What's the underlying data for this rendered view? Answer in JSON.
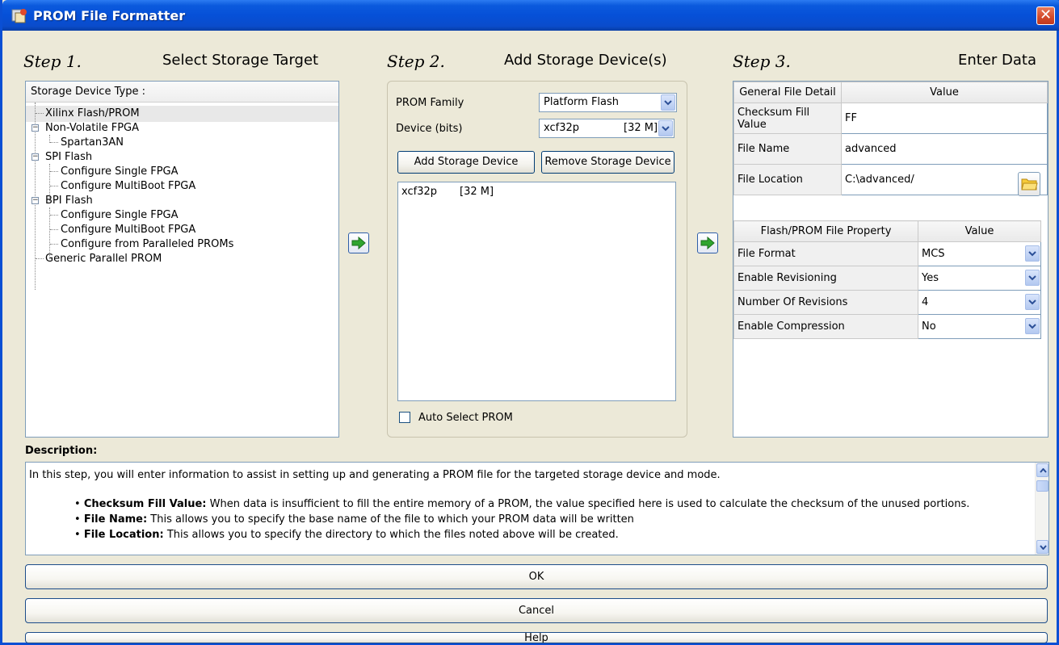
{
  "window": {
    "title": "PROM File Formatter",
    "close_glyph": "✕"
  },
  "steps": [
    {
      "num": "Step 1.",
      "label": "Select Storage Target"
    },
    {
      "num": "Step 2.",
      "label": "Add Storage Device(s)"
    },
    {
      "num": "Step 3.",
      "label": "Enter Data"
    }
  ],
  "storage_tree": {
    "header": "Storage Device Type :",
    "items": [
      "Xilinx Flash/PROM",
      "Non-Volatile FPGA",
      "Spartan3AN",
      "SPI Flash",
      "Configure Single FPGA",
      "Configure MultiBoot FPGA",
      "BPI Flash",
      "Configure Single FPGA",
      "Configure MultiBoot FPGA",
      "Configure from Paralleled PROMs",
      "Generic Parallel PROM"
    ],
    "expander_glyph": "−"
  },
  "step2": {
    "prom_family_label": "PROM Family",
    "prom_family_value": "Platform Flash",
    "device_label": "Device (bits)",
    "device_name": "xcf32p",
    "device_size": "[32 M]",
    "add_button": "Add Storage Device",
    "remove_button": "Remove Storage Device",
    "device_list": [
      {
        "name": "xcf32p",
        "size": "[32 M]"
      }
    ],
    "auto_select_label": "Auto Select PROM",
    "auto_select_checked": false
  },
  "general_detail": {
    "col1": "General File Detail",
    "col2": "Value",
    "rows": [
      {
        "label": "Checksum Fill Value",
        "value": "FF"
      },
      {
        "label": "File Name",
        "value": "advanced"
      },
      {
        "label": "File Location",
        "value": "C:\\advanced/"
      }
    ]
  },
  "flash_property": {
    "col1": "Flash/PROM File Property",
    "col2": "Value",
    "rows": [
      {
        "label": "File Format",
        "value": "MCS"
      },
      {
        "label": "Enable Revisioning",
        "value": "Yes"
      },
      {
        "label": "Number Of Revisions",
        "value": "4"
      },
      {
        "label": "Enable Compression",
        "value": "No"
      }
    ]
  },
  "description": {
    "title": "Description:",
    "intro": "In this step, you will enter information to assist in setting up and generating a PROM file for the targeted storage device and mode.",
    "bullets": [
      {
        "term": "Checksum Fill Value:",
        "text": " When data is insufficient to fill the entire memory of a PROM, the value specified here is used to calculate the checksum of the unused portions."
      },
      {
        "term": "File Name:",
        "text": " This allows you to specify the base name of the file to which your PROM data will be written"
      },
      {
        "term": "File Location:",
        "text": " This allows you to specify the directory to which the files noted above will be created."
      }
    ]
  },
  "buttons": {
    "ok": "OK",
    "cancel": "Cancel",
    "help": "Help"
  },
  "colors": {
    "title_bar": "#0650D8",
    "panel_border": "#7F9DB9",
    "dialog_bg": "#ECE9D8",
    "arrow_green": "#2FA52F",
    "folder_yellow": "#F6CB3A"
  }
}
